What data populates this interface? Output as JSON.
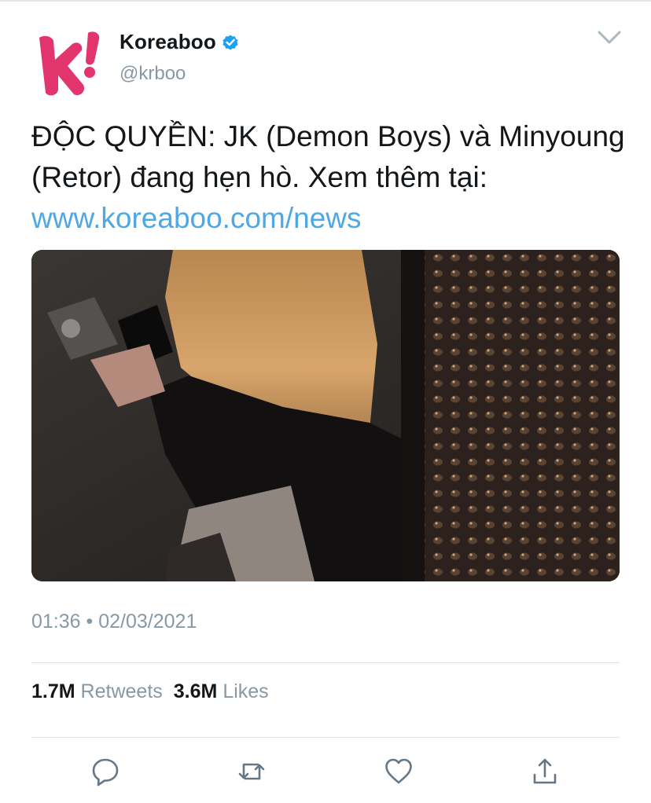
{
  "author": {
    "display_name": "Koreaboo",
    "handle": "@krboo",
    "verified": true,
    "avatar_icon": "koreaboo-k-logo",
    "avatar_color": "#e3356d"
  },
  "tweet": {
    "text_before_link": "ĐỘC QUYỀN: JK (Demon Boys) và Minyoung (Retor) đang hẹn hò. Xem thêm tại: ",
    "link_text": "www.koreaboo.com/news",
    "link_color": "#4fa8e6",
    "time": "01:36",
    "separator": "•",
    "date": "02/03/2021"
  },
  "stats": {
    "retweets_count": "1.7M",
    "retweets_label": "Retweets",
    "likes_count": "3.6M",
    "likes_label": "Likes"
  },
  "actions": {
    "reply_icon": "reply-icon",
    "retweet_icon": "retweet-icon",
    "like_icon": "heart-icon",
    "share_icon": "share-icon",
    "icon_color": "#657786"
  },
  "colors": {
    "text": "#14171a",
    "secondary": "#8899a6",
    "verified_badge": "#1da1f2"
  }
}
